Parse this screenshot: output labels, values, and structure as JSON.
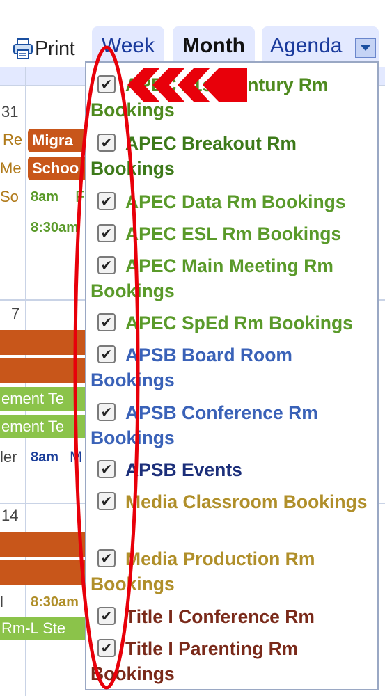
{
  "toolbar": {
    "print_label": "Print",
    "tabs": {
      "week": "Week",
      "month": "Month",
      "agenda": "Agenda"
    }
  },
  "calendar": {
    "day_numbers": [
      "31",
      "7",
      "14"
    ],
    "events": {
      "r1_left": "Re",
      "r2_left": "Me",
      "r3_left": "So",
      "chip1": "Migra",
      "chip2": "Schoo",
      "time1": "8am",
      "time1_tail": "F",
      "time2": "8:30am",
      "week2_green1": "ement Te",
      "week2_green2": "ement Te",
      "week2_left": "ler",
      "week2_time": "8am",
      "week2_time_tail": "M",
      "week3_left": "l",
      "week3_time": "8:30am",
      "week3_green": "Rm-L Ste"
    }
  },
  "menu": {
    "items": [
      {
        "label": "APEC 21st Century Rm Bookings",
        "color": "#4e8a1e",
        "checked": true
      },
      {
        "label": "APEC Breakout Rm Bookings",
        "color": "#3d7a1a",
        "checked": true
      },
      {
        "label": "APEC Data Rm Bookings",
        "color": "#5a9a2a",
        "checked": true
      },
      {
        "label": "APEC ESL Rm Bookings",
        "color": "#5a9a2a",
        "checked": true
      },
      {
        "label": "APEC Main Meeting Rm Bookings",
        "color": "#5a9a2a",
        "checked": true
      },
      {
        "label": "APEC SpEd Rm Bookings",
        "color": "#5a9a2a",
        "checked": true
      },
      {
        "label": "APSB Board Room Bookings",
        "color": "#3a62b8",
        "checked": true
      },
      {
        "label": "APSB Conference Rm Bookings",
        "color": "#3a62b8",
        "checked": true
      },
      {
        "label": "APSB Events",
        "color": "#1c2f7a",
        "checked": true
      },
      {
        "label": "Media Classroom Bookings",
        "color": "#b08f2a",
        "checked": true
      },
      {
        "label": "Media Production Rm Bookings",
        "color": "#b08f2a",
        "checked": true
      },
      {
        "label": "Title I Conference Rm",
        "color": "#7a2a1a",
        "checked": true
      },
      {
        "label": "Title I Parenting Rm Bookings",
        "color": "#7a2a1a",
        "checked": true
      }
    ],
    "check_glyph": "✔"
  },
  "colors": {
    "annotation": "#e8000a",
    "orange_event": "#c8561a",
    "green_event": "#8bc34a",
    "tab_bg": "#e3e9ff"
  },
  "icons": [
    "printer-icon",
    "chevron-down-icon",
    "checkbox-icon",
    "arrow-annotation",
    "ellipse-annotation"
  ]
}
